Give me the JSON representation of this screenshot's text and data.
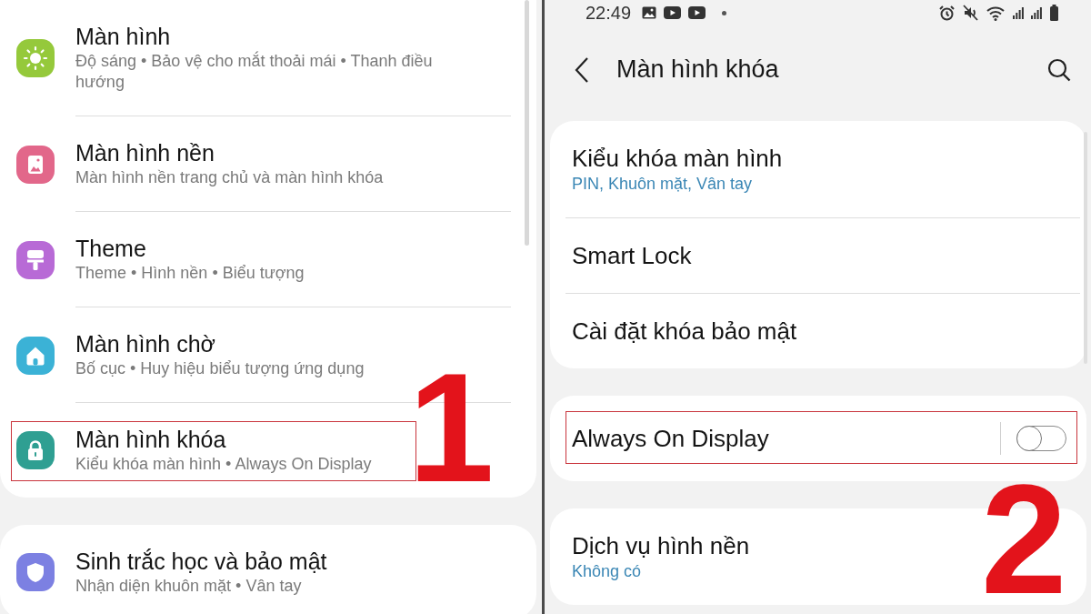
{
  "left_panel": {
    "groups": [
      {
        "items": [
          {
            "title": "Màn hình",
            "subtitle": "Độ sáng • Bảo vệ cho mắt thoải mái • Thanh điều hướng",
            "color": "#95c93b",
            "highlighted": false
          },
          {
            "title": "Màn hình nền",
            "subtitle": "Màn hình nền trang chủ và màn hình khóa",
            "color": "#e2678a",
            "highlighted": false
          },
          {
            "title": "Theme",
            "subtitle": "Theme • Hình nền • Biểu tượng",
            "color": "#b86ad6",
            "highlighted": false
          },
          {
            "title": "Màn hình chờ",
            "subtitle": "Bố cục • Huy hiệu biểu tượng ứng dụng",
            "color": "#3bb2d6",
            "highlighted": false
          },
          {
            "title": "Màn hình khóa",
            "subtitle": "Kiểu khóa màn hình • Always On Display",
            "color": "#2f9f92",
            "highlighted": true
          }
        ]
      },
      {
        "items": [
          {
            "title": "Sinh trắc học và bảo mật",
            "subtitle": "Nhận diện khuôn mặt • Vân tay",
            "color": "#7c80e2",
            "highlighted": false
          }
        ]
      }
    ],
    "step_label": "1"
  },
  "right_panel": {
    "status_bar": {
      "time": "22:49"
    },
    "header": {
      "title": "Màn hình khóa"
    },
    "groups": [
      {
        "items": [
          {
            "kind": "text",
            "title": "Kiểu khóa màn hình",
            "subtitle": "PIN, Khuôn mặt, Vân tay",
            "highlighted": false
          },
          {
            "kind": "text",
            "title": "Smart Lock",
            "highlighted": false
          },
          {
            "kind": "text",
            "title": "Cài đặt khóa bảo mật",
            "highlighted": false
          }
        ]
      },
      {
        "items": [
          {
            "kind": "toggle",
            "title": "Always On Display",
            "on": false,
            "highlighted": true
          }
        ]
      },
      {
        "items": [
          {
            "kind": "text",
            "title": "Dịch vụ hình nền",
            "subtitle": "Không có",
            "highlighted": false
          }
        ]
      }
    ],
    "step_label": "2"
  }
}
